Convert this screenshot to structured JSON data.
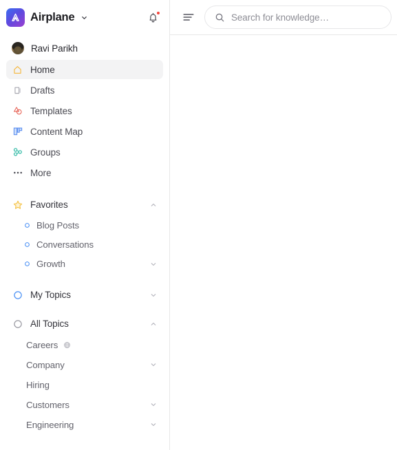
{
  "workspace": {
    "name": "Airplane",
    "logo_letter": "A",
    "dropdown_icon": "chevron-down-icon",
    "notifications_icon": "bell-icon",
    "has_unread": true,
    "accent_gradient_from": "#3a6ef0",
    "accent_gradient_to": "#9b3fd0"
  },
  "sidebar": {
    "user": {
      "name": "Ravi Parikh",
      "avatar": "user-avatar"
    },
    "nav": [
      {
        "label": "Home",
        "icon": "home-icon",
        "active": true,
        "color": "#f5b73d"
      },
      {
        "label": "Drafts",
        "icon": "drafts-icon",
        "active": false,
        "color": "#a8a8b0"
      },
      {
        "label": "Templates",
        "icon": "templates-icon",
        "active": false,
        "color": "#e8685c"
      },
      {
        "label": "Content Map",
        "icon": "content-map-icon",
        "active": false,
        "color": "#5a8ef0"
      },
      {
        "label": "Groups",
        "icon": "groups-icon",
        "active": false,
        "color": "#2bb8a3"
      },
      {
        "label": "More",
        "icon": "more-icon",
        "active": false,
        "color": "#4a4a52"
      }
    ],
    "favorites": {
      "label": "Favorites",
      "icon": "star-icon",
      "icon_color": "#f5c244",
      "chevron": "chevron-up-icon",
      "expanded": true,
      "items": [
        {
          "label": "Blog Posts",
          "icon": "circle-icon",
          "color": "#4a90f5",
          "chevron": null
        },
        {
          "label": "Conversations",
          "icon": "circle-icon",
          "color": "#4a90f5",
          "chevron": null
        },
        {
          "label": "Growth",
          "icon": "circle-icon",
          "color": "#4a90f5",
          "chevron": "chevron-down-icon"
        }
      ]
    },
    "my_topics": {
      "label": "My Topics",
      "icon": "circle-icon",
      "icon_color": "#4a90f5",
      "chevron": "chevron-down-icon",
      "expanded": false
    },
    "all_topics": {
      "label": "All Topics",
      "icon": "circle-icon",
      "icon_color": "#8e8e96",
      "chevron": "chevron-up-icon",
      "expanded": true,
      "items": [
        {
          "label": "Careers",
          "chevron": null,
          "badge_icon": "globe-icon"
        },
        {
          "label": "Company",
          "chevron": "chevron-down-icon",
          "badge_icon": null
        },
        {
          "label": "Hiring",
          "chevron": null,
          "badge_icon": null
        },
        {
          "label": "Customers",
          "chevron": "chevron-down-icon",
          "badge_icon": null
        },
        {
          "label": "Engineering",
          "chevron": "chevron-down-icon",
          "badge_icon": null
        }
      ]
    }
  },
  "topbar": {
    "menu_icon": "hamburger-menu-icon",
    "search": {
      "icon": "search-icon",
      "value": "",
      "placeholder": "Search for knowledge…"
    }
  }
}
